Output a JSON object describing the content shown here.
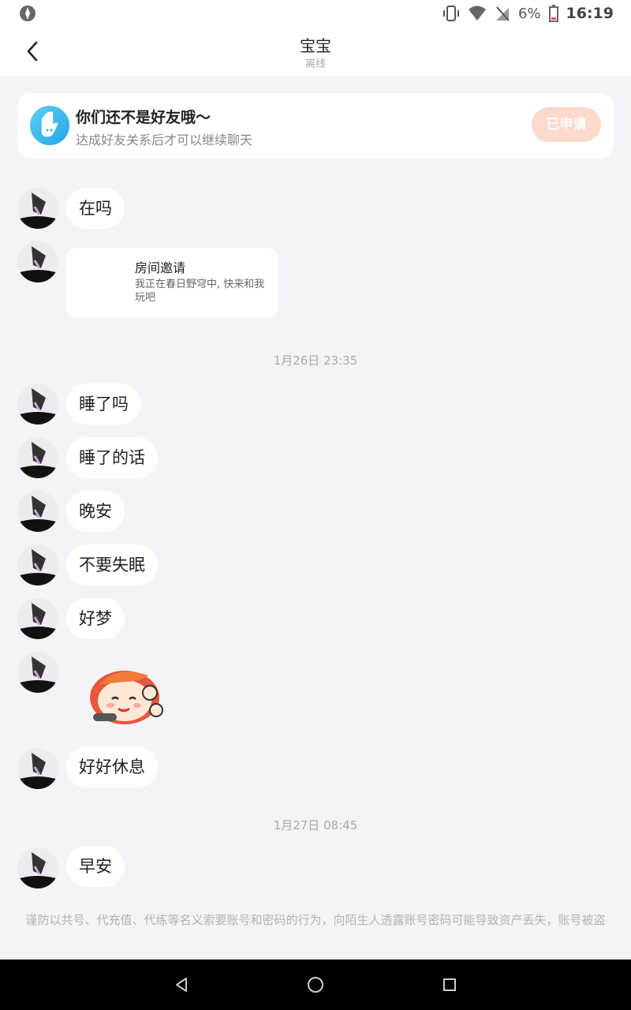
{
  "status_bar": {
    "battery_percent": "6%",
    "time": "16:19"
  },
  "header": {
    "title": "宝宝",
    "subtitle": "离线"
  },
  "notice": {
    "title": "你们还不是好友哦～",
    "subtitle": "达成好友关系后才可以继续聊天",
    "button_label": "已申请"
  },
  "messages": [
    {
      "text": "在吗"
    },
    {
      "card_title": "房间邀请",
      "card_desc": "我正在春日野穹中, 快来和我玩吧"
    },
    {
      "timestamp": "1月26日 23:35"
    },
    {
      "text": "睡了吗"
    },
    {
      "text": "睡了的话"
    },
    {
      "text": "晚安"
    },
    {
      "text": "不要失眠"
    },
    {
      "text": "好梦"
    },
    {
      "sticker": "sticker-icon"
    },
    {
      "text": "好好休息"
    },
    {
      "timestamp": "1月27日 08:45"
    },
    {
      "text": "早安"
    }
  ],
  "footer_warning": "谨防以共号、代充值、代练等名义索要账号和密码的行为，向陌生人透露账号密码可能导致资产丢失，账号被盗"
}
